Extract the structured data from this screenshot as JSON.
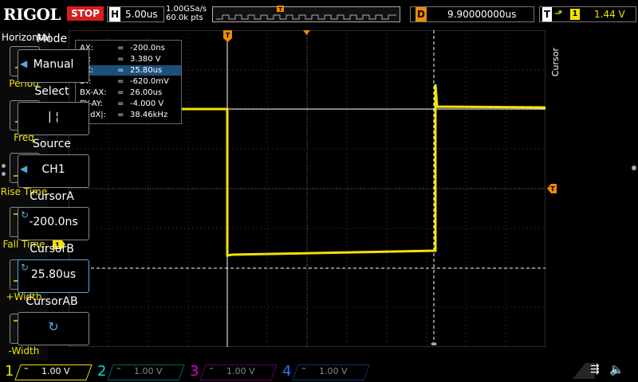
{
  "top": {
    "logo": "RIGOL",
    "run_state": "STOP",
    "timebase_label": "H",
    "timebase_value": "5.00us",
    "sample_rate": "1.00GSa/s",
    "memory_depth": "60.0k pts",
    "delay_label": "D",
    "delay_value": "9.90000000us",
    "trigger_label": "T",
    "trigger_edge": "⬏",
    "trigger_channel": "1",
    "trigger_level": "1.44 V"
  },
  "horizontal": {
    "title": "Horizontal",
    "items": [
      {
        "label": "Period",
        "icon": "period-icon"
      },
      {
        "label": "Freq",
        "icon": "freq-icon"
      },
      {
        "label": "Rise Time",
        "icon": "rise-time-icon"
      },
      {
        "label": "Fall Time",
        "icon": "fall-time-icon"
      },
      {
        "label": "+Width",
        "icon": "plus-width-icon"
      },
      {
        "label": "-Width",
        "icon": "minus-width-icon"
      }
    ]
  },
  "cursor_table": {
    "rows": [
      {
        "key": "AX:",
        "value": "-200.0ns"
      },
      {
        "key": "AY:",
        "value": "3.380 V"
      },
      {
        "key": "BX:",
        "value": "25.80us"
      },
      {
        "key": "BY:",
        "value": "-620.0mV"
      },
      {
        "key": "BX-AX:",
        "value": "26.00us"
      },
      {
        "key": "BY-AY:",
        "value": "-4.000 V"
      },
      {
        "key": "1/|dX|:",
        "value": "38.46kHz"
      }
    ],
    "selected_row": 2,
    "equals": "="
  },
  "menu": {
    "side_label": "Cursor",
    "mode_title": "Mode",
    "mode_value": "Manual",
    "select_title": "Select",
    "select_value": "| ¦",
    "source_title": "Source",
    "source_value": "CH1",
    "cursor_a_title": "CursorA",
    "cursor_a_value": "-200.0ns",
    "cursor_b_title": "CursorB",
    "cursor_b_value": "25.80us",
    "cursor_ab_title": "CursorAB"
  },
  "channels": [
    {
      "num": "1",
      "value": "1.00 V",
      "color": "#f2e200",
      "active": true
    },
    {
      "num": "2",
      "value": "1.00 V",
      "color": "#00e0e0",
      "active": false
    },
    {
      "num": "3",
      "value": "1.00 V",
      "color": "#e000e0",
      "active": false
    },
    {
      "num": "4",
      "value": "1.00 V",
      "color": "#2f6fff",
      "active": false
    }
  ],
  "markers": {
    "trigger_marker": "T",
    "ch1_ground_marker": "1"
  },
  "colors": {
    "trace": "#f2e200",
    "accent": "#f08a00",
    "stop": "#d31f1f",
    "selected": "#1d4f7a"
  }
}
